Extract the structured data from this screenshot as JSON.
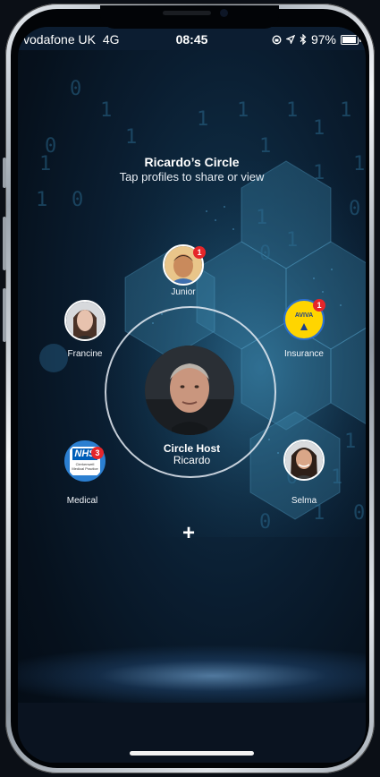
{
  "status_bar": {
    "carrier": "vodafone UK",
    "network": "4G",
    "time": "08:45",
    "battery_percent": "97%",
    "icons": [
      "orientation-lock-icon",
      "location-arrow-icon",
      "bluetooth-icon",
      "battery-icon"
    ]
  },
  "header": {
    "title": "Ricardo’s Circle",
    "subtitle": "Tap profiles to share or view"
  },
  "host": {
    "title": "Circle Host",
    "name": "Ricardo"
  },
  "profiles": [
    {
      "id": "junior",
      "label": "Junior",
      "badge": "1"
    },
    {
      "id": "francine",
      "label": "Francine",
      "badge": ""
    },
    {
      "id": "insurance",
      "label": "Insurance",
      "badge": "1",
      "logo_text": "AVIVA",
      "logo_color": "#ffd500"
    },
    {
      "id": "medical",
      "label": "Medical",
      "badge": "3",
      "logo_text": "NHS",
      "logo_sub": "Clerkenwell Medical Practice",
      "logo_color": "#005eb8"
    },
    {
      "id": "selma",
      "label": "Selma",
      "badge": ""
    }
  ],
  "actions": {
    "add_symbol": "+"
  },
  "colors": {
    "badge": "#e5262a",
    "background": "#0a1d30",
    "accent_blue": "#4fa3e0"
  }
}
